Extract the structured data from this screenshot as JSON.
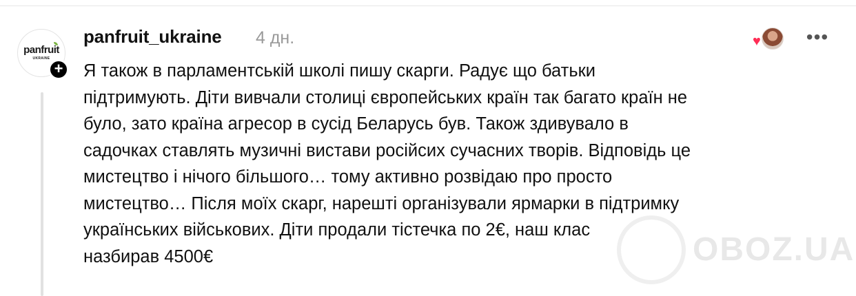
{
  "post": {
    "username": "panfruit_ukraine",
    "time": "4 дн.",
    "avatar_logo": "panfruit",
    "avatar_logo_sub": "UKRAINE",
    "follow_symbol": "+",
    "more_symbol": "•••",
    "comment_lines": [
      "Я також в парламентській школі пишу скарги. Радує що батьки",
      "підтримують. Діти вивчали столиці європейських країн так багато країн не",
      "було, зато країна агресор в сусід Беларусь був. Також здивувало в",
      "садочках ставлять музичні вистави російсих сучасних творів. Відповідь це",
      "мистецтво і нічого більшого… тому активно розвідаю про просто",
      "мистецтво… Після моїх скарг, нарешті організували ярмарки в підтримку",
      "українських військових. Діти продали тістечка по 2€, наш клас",
      "назбирав 4500€"
    ]
  },
  "watermark": {
    "text": "OBOZ.UA"
  },
  "colors": {
    "text": "#111111",
    "muted": "#9a9a9a",
    "heart": "#ff2d55",
    "thread_line": "#e1e1e1"
  },
  "icons": {
    "follow": "plus-icon",
    "liked": "heart-icon",
    "more": "more-icon"
  }
}
